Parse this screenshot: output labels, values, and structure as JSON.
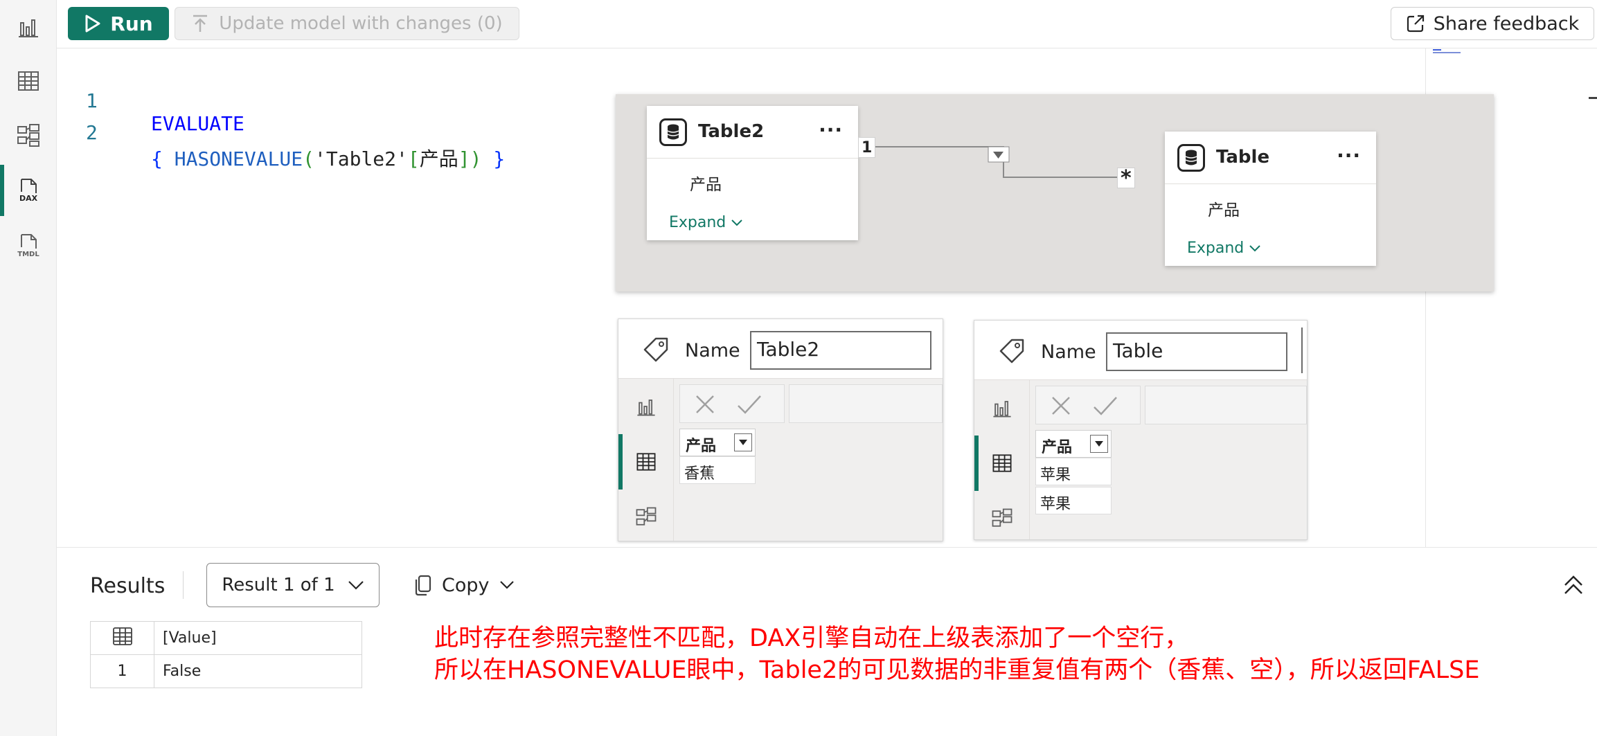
{
  "rail": {
    "items": [
      {
        "name": "report-view",
        "icon": "bar-chart-icon"
      },
      {
        "name": "table-view",
        "icon": "table-grid-icon"
      },
      {
        "name": "model-view",
        "icon": "model-diagram-icon"
      },
      {
        "name": "dax-query-view",
        "icon": "dax-document-icon",
        "active": true
      },
      {
        "name": "tmdl-view",
        "icon": "tmdl-document-icon"
      }
    ]
  },
  "toolbar": {
    "run_label": "Run",
    "update_label": "Update model with changes (0)",
    "feedback_label": "Share feedback"
  },
  "editor": {
    "lines": [
      {
        "number": "1",
        "text": "EVALUATE"
      },
      {
        "number": "2",
        "text": "{ HASONEVALUE('Table2'[产品]) }"
      }
    ]
  },
  "diagram": {
    "left_table": {
      "name": "Table2",
      "column": "产品",
      "expand": "Expand",
      "more": "···"
    },
    "right_table": {
      "name": "Table",
      "column": "产品",
      "expand": "Expand",
      "more": "···"
    },
    "relationship": {
      "one_side": "1",
      "many_side": "*"
    }
  },
  "panes": [
    {
      "name_label": "Name",
      "name_value": "Table2",
      "column": "产品",
      "rows": [
        "香蕉"
      ]
    },
    {
      "name_label": "Name",
      "name_value": "Table",
      "column": "产品",
      "rows": [
        "苹果",
        "苹果"
      ]
    }
  ],
  "results": {
    "title": "Results",
    "dropdown": "Result 1 of 1",
    "copy": "Copy",
    "table": {
      "header": "[Value]",
      "rows": [
        {
          "index": "1",
          "value": "False"
        }
      ]
    },
    "annotation_line1": "此时存在参照完整性不匹配，DAX引擎自动在上级表添加了一个空行，",
    "annotation_line2": "所以在HASONEVALUE眼中，Table2的可见数据的非重复值有两个（香蕉、空），所以返回FALSE"
  },
  "colors": {
    "accent": "#117865",
    "annotation": "#ff0000"
  }
}
